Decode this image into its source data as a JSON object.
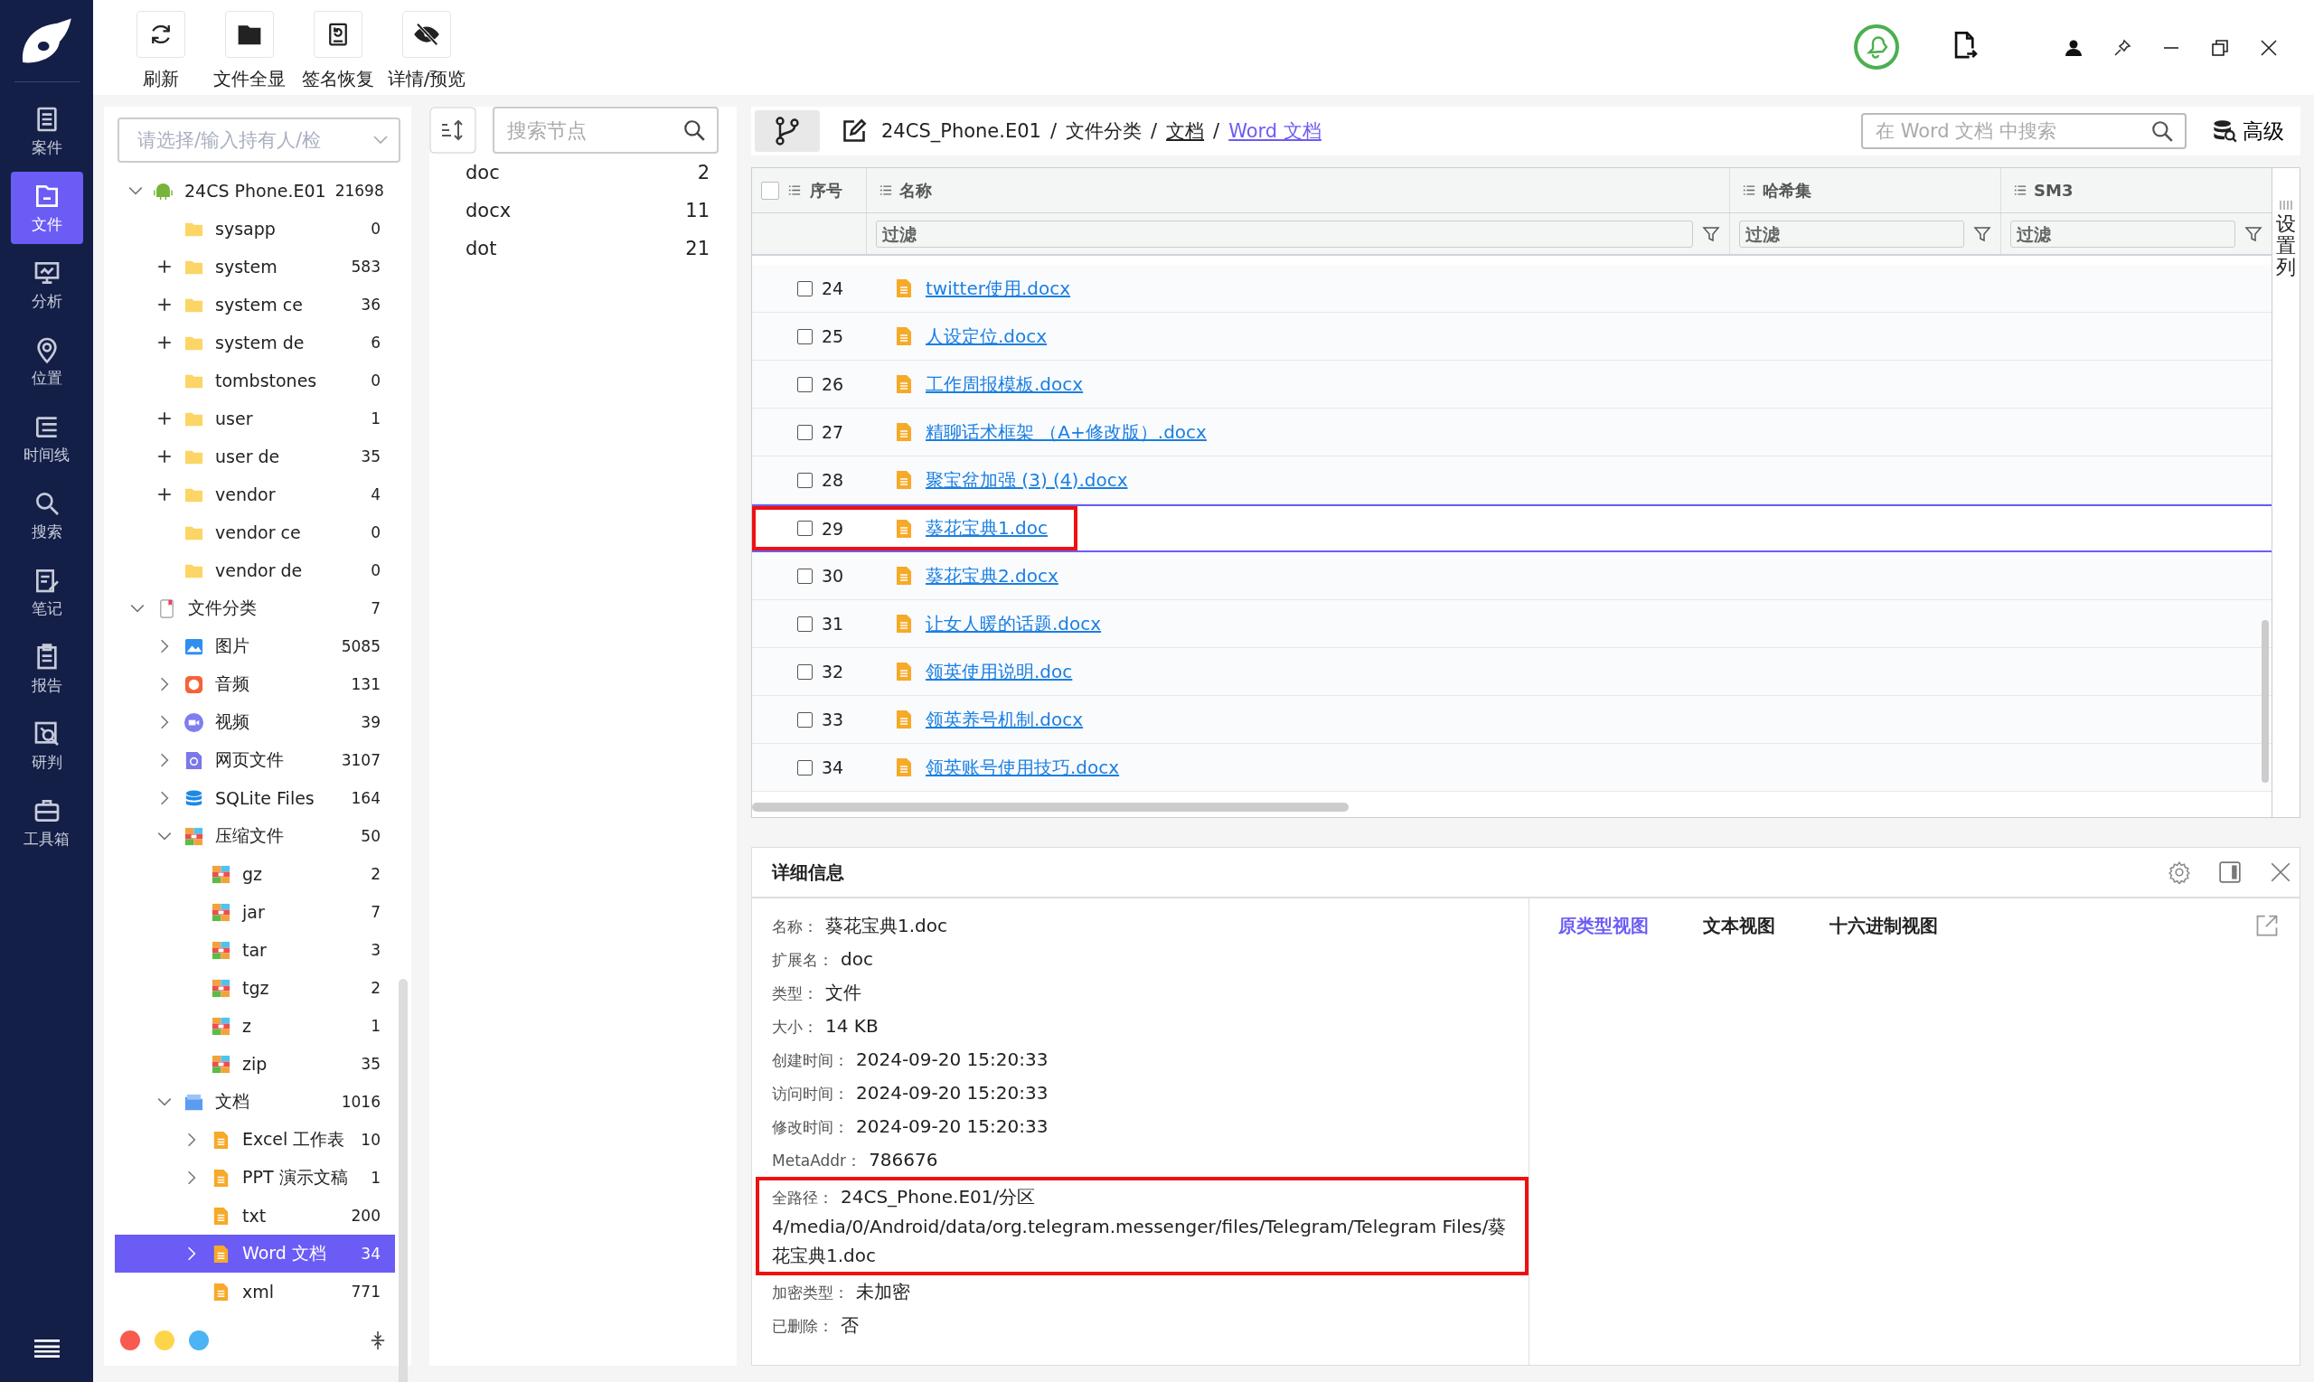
{
  "nav": [
    {
      "kind": "case",
      "label": "案件",
      "selected": false
    },
    {
      "kind": "file",
      "label": "文件",
      "selected": true
    },
    {
      "kind": "analysis",
      "label": "分析",
      "selected": false
    },
    {
      "kind": "location",
      "label": "位置",
      "selected": false
    },
    {
      "kind": "timeline",
      "label": "时间线",
      "selected": false
    },
    {
      "kind": "search",
      "label": "搜索",
      "selected": false
    },
    {
      "kind": "notes",
      "label": "笔记",
      "selected": false
    },
    {
      "kind": "report",
      "label": "报告",
      "selected": false
    },
    {
      "kind": "judge",
      "label": "研判",
      "selected": false
    },
    {
      "kind": "toolbox",
      "label": "工具箱",
      "selected": false
    }
  ],
  "toolbar": [
    {
      "kind": "refresh",
      "label": "刷新"
    },
    {
      "kind": "folder",
      "label": "文件全显"
    },
    {
      "kind": "restore",
      "label": "签名恢复"
    },
    {
      "kind": "hidden",
      "label": "详情/预览"
    }
  ],
  "owner_select": {
    "placeholder": "请选择/输入持有人/检"
  },
  "tree": [
    {
      "kind": "device",
      "label": "24CS Phone.E01",
      "count": "21698",
      "expanded": true,
      "selected": false,
      "children": [
        {
          "kind": "folder",
          "label": "sysapp",
          "count": "0",
          "selected": false
        },
        {
          "kind": "folder",
          "label": "system",
          "count": "583",
          "expanded": false,
          "selected": false
        },
        {
          "kind": "folder",
          "label": "system ce",
          "count": "36",
          "expanded": false,
          "selected": false
        },
        {
          "kind": "folder",
          "label": "system de",
          "count": "6",
          "expanded": false,
          "selected": false
        },
        {
          "kind": "folder",
          "label": "tombstones",
          "count": "0",
          "selected": false
        },
        {
          "kind": "folder",
          "label": "user",
          "count": "1",
          "expanded": false,
          "selected": false
        },
        {
          "kind": "folder",
          "label": "user de",
          "count": "35",
          "expanded": false,
          "selected": false
        },
        {
          "kind": "folder",
          "label": "vendor",
          "count": "4",
          "expanded": false,
          "selected": false
        },
        {
          "kind": "folder",
          "label": "vendor ce",
          "count": "0",
          "selected": false
        },
        {
          "kind": "folder",
          "label": "vendor de",
          "count": "0",
          "selected": false
        }
      ]
    },
    {
      "kind": "category",
      "label": "文件分类",
      "count": "7",
      "expanded": true,
      "selected": false,
      "children": [
        {
          "kind": "image",
          "label": "图片",
          "count": "5085",
          "expanded": false,
          "selected": false
        },
        {
          "kind": "audio",
          "label": "音频",
          "count": "131",
          "expanded": false,
          "selected": false
        },
        {
          "kind": "video",
          "label": "视频",
          "count": "39",
          "expanded": false,
          "selected": false
        },
        {
          "kind": "web",
          "label": "网页文件",
          "count": "3107",
          "expanded": false,
          "selected": false
        },
        {
          "kind": "sqlite",
          "label": "SQLite Files",
          "count": "164",
          "expanded": false,
          "selected": false
        },
        {
          "kind": "archive",
          "label": "压缩文件",
          "count": "50",
          "expanded": true,
          "selected": false,
          "children": [
            {
              "kind": "archive",
              "label": "gz",
              "count": "2",
              "selected": false
            },
            {
              "kind": "archive",
              "label": "jar",
              "count": "7",
              "selected": false
            },
            {
              "kind": "archive",
              "label": "tar",
              "count": "3",
              "selected": false
            },
            {
              "kind": "archive",
              "label": "tgz",
              "count": "2",
              "selected": false
            },
            {
              "kind": "archive",
              "label": "z",
              "count": "1",
              "selected": false
            },
            {
              "kind": "archive",
              "label": "zip",
              "count": "35",
              "selected": false
            }
          ]
        },
        {
          "kind": "docs",
          "label": "文档",
          "count": "1016",
          "expanded": true,
          "selected": false,
          "children": [
            {
              "kind": "doc",
              "label": "Excel 工作表",
              "count": "10",
              "expanded": false,
              "selected": false
            },
            {
              "kind": "doc",
              "label": "PPT 演示文稿",
              "count": "1",
              "expanded": false,
              "selected": false
            },
            {
              "kind": "doc",
              "label": "txt",
              "count": "200",
              "selected": false
            },
            {
              "kind": "doc",
              "label": "Word 文档",
              "count": "34",
              "expanded": false,
              "selected": true
            },
            {
              "kind": "doc",
              "label": "xml",
              "count": "771",
              "selected": false
            }
          ]
        }
      ]
    }
  ],
  "tag_dots": [
    {
      "color": "#f85a50"
    },
    {
      "color": "#fcd54a"
    },
    {
      "color": "#4cb4f4"
    }
  ],
  "node_search": {
    "placeholder": "搜索节点"
  },
  "extensions": [
    {
      "label": "doc",
      "count": "2"
    },
    {
      "label": "docx",
      "count": "11"
    },
    {
      "label": "dot",
      "count": "21"
    }
  ],
  "breadcrumb": [
    {
      "kind": "item",
      "label": "24CS_Phone.E01",
      "link": false,
      "current": false
    },
    {
      "kind": "separator",
      "label": "/"
    },
    {
      "kind": "item",
      "label": "文件分类",
      "link": false,
      "current": false
    },
    {
      "kind": "separator",
      "label": "/"
    },
    {
      "kind": "item",
      "label": "文档",
      "link": true,
      "current": false
    },
    {
      "kind": "separator",
      "label": "/"
    },
    {
      "kind": "item",
      "label": "Word 文档",
      "link": true,
      "current": true
    }
  ],
  "search": {
    "placeholder": "在 Word 文档 中搜索"
  },
  "advanced_button": "高级",
  "table": {
    "all_checked": false,
    "columns": [
      {
        "label": "序号"
      },
      {
        "label": "名称",
        "filter": {
          "placeholder": "过滤"
        }
      },
      {
        "label": "哈希集",
        "filter": {
          "placeholder": "过滤"
        }
      },
      {
        "label": "SM3",
        "filter": {
          "placeholder": "过滤"
        }
      }
    ],
    "settings_tab": "设置列",
    "rows": [
      {
        "index": "24",
        "name": "twitter使用.docx",
        "checked": false,
        "selected": false,
        "marked": false
      },
      {
        "index": "25",
        "name": "人设定位.docx",
        "checked": false,
        "selected": false,
        "marked": false
      },
      {
        "index": "26",
        "name": "工作周报模板.docx",
        "checked": false,
        "selected": false,
        "marked": false
      },
      {
        "index": "27",
        "name": "精聊话术框架 （A+修改版）.docx",
        "checked": false,
        "selected": false,
        "marked": false
      },
      {
        "index": "28",
        "name": "聚宝盆加强 (3) (4).docx",
        "checked": false,
        "selected": false,
        "marked": false
      },
      {
        "index": "29",
        "name": "葵花宝典1.doc",
        "checked": false,
        "selected": true,
        "marked": true
      },
      {
        "index": "30",
        "name": "葵花宝典2.docx",
        "checked": false,
        "selected": false,
        "marked": false
      },
      {
        "index": "31",
        "name": "让女人暖的话题.docx",
        "checked": false,
        "selected": false,
        "marked": false
      },
      {
        "index": "32",
        "name": "领英使用说明.doc",
        "checked": false,
        "selected": false,
        "marked": false
      },
      {
        "index": "33",
        "name": "领英养号机制.docx",
        "checked": false,
        "selected": false,
        "marked": false
      },
      {
        "index": "34",
        "name": "领英账号使用技巧.docx",
        "checked": false,
        "selected": false,
        "marked": false
      }
    ]
  },
  "details": {
    "title": "详细信息",
    "fields": [
      {
        "label": "名称：",
        "value": "葵花宝典1.doc",
        "marked": false
      },
      {
        "label": "扩展名：",
        "value": "doc",
        "marked": false
      },
      {
        "label": "类型：",
        "value": "文件",
        "marked": false
      },
      {
        "label": "大小：",
        "value": "14 KB",
        "marked": false
      },
      {
        "label": "创建时间：",
        "value": "2024-09-20 15:20:33",
        "marked": false
      },
      {
        "label": "访问时间：",
        "value": "2024-09-20 15:20:33",
        "marked": false
      },
      {
        "label": "修改时间：",
        "value": "2024-09-20 15:20:33",
        "marked": false
      },
      {
        "label": "MetaAddr：",
        "value": "786676",
        "marked": false
      },
      {
        "label": "全路径：",
        "value": "24CS_Phone.E01/分区 4/media/0/Android/data/org.telegram.messenger/files/Telegram/Telegram Files/葵花宝典1.doc",
        "marked": true
      },
      {
        "label": "加密类型：",
        "value": "未加密",
        "marked": false
      },
      {
        "label": "已删除：",
        "value": "否",
        "marked": false
      }
    ],
    "view_tabs": [
      {
        "label": "原类型视图",
        "selected": true
      },
      {
        "label": "文本视图",
        "selected": false
      },
      {
        "label": "十六进制视图",
        "selected": false
      }
    ]
  }
}
